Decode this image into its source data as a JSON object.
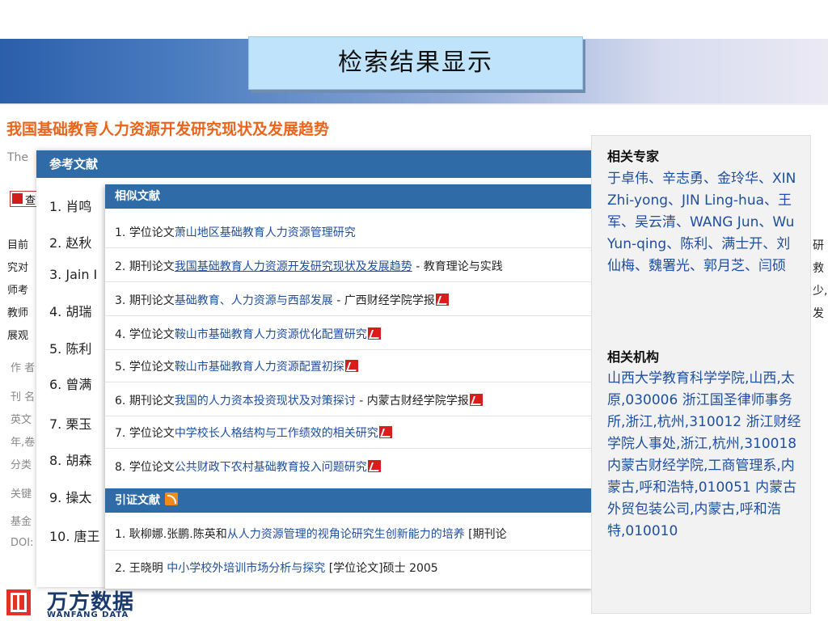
{
  "slide_title": "检索结果显示",
  "article": {
    "title": "我国基础教育人力资源开发研究现状及发展趋势",
    "en_fragment": "The",
    "pdf_label": "查",
    "body_fragments": [
      "目前",
      "究对",
      "师考",
      "教师",
      "展观"
    ],
    "meta_labels": [
      "作 者",
      "刊 名",
      "英文",
      "年,卷",
      "分类",
      "关键",
      "基金",
      "DOI:"
    ]
  },
  "references": {
    "header": "参考文献",
    "items": [
      "1. 肖鸣",
      "2. 赵秋",
      "3. Jain I",
      "4. 胡瑞",
      "5. 陈利",
      "6. 曾满",
      "7. 栗玉",
      "8. 胡森",
      "9. 操太",
      "10. 唐王"
    ]
  },
  "similar": {
    "header": "相似文献",
    "items": [
      {
        "num": "1.",
        "type": "学位论文",
        "title": "萧山地区基础教育人力资源管理研究",
        "source": "",
        "pdf": false,
        "underline": false
      },
      {
        "num": "2.",
        "type": "期刊论文",
        "title": "我国基础教育人力资源开发研究现状及发展趋势",
        "source": " - 教育理论与实践",
        "pdf": false,
        "underline": true
      },
      {
        "num": "3.",
        "type": "期刊论文",
        "title": "基础教育、人力资源与西部发展",
        "source": " - 广西财经学院学报",
        "pdf": true,
        "underline": false
      },
      {
        "num": "4.",
        "type": "学位论文",
        "title": "鞍山市基础教育人力资源优化配置研究",
        "source": "",
        "pdf": true,
        "underline": false
      },
      {
        "num": "5.",
        "type": "学位论文",
        "title": "鞍山市基础教育人力资源配置初探",
        "source": "",
        "pdf": true,
        "underline": false
      },
      {
        "num": "6.",
        "type": "期刊论文",
        "title": "我国的人力资本投资现状及对策探讨",
        "source": " - 内蒙古财经学院学报",
        "pdf": true,
        "underline": false
      },
      {
        "num": "7.",
        "type": "学位论文",
        "title": "中学校长人格结构与工作绩效的相关研究",
        "source": "",
        "pdf": true,
        "underline": false
      },
      {
        "num": "8.",
        "type": "学位论文",
        "title": "公共财政下农村基础教育投入问题研究",
        "source": "",
        "pdf": true,
        "underline": false
      }
    ]
  },
  "citing": {
    "header": "引证文献",
    "items": [
      {
        "prefix": "1. 耿柳娜.张鹏.陈英和",
        "title": "从人力资源管理的视角论研究生创新能力的培养",
        "suffix": " [期刊论"
      },
      {
        "prefix": "2. 王晓明 ",
        "title": "中小学校外培训市场分析与探究",
        "suffix": " [学位论文]硕士 2005"
      }
    ]
  },
  "sidebar": {
    "experts_head": "相关专家",
    "experts": "于卓伟、辛志勇、金玲华、XIN Zhi-yong、JIN Ling-hua、王军、吴云清、WANG Jun、Wu Yun-qing、陈利、满士开、刘仙梅、魏署光、郭月芝、闫硕",
    "orgs_head": "相关机构",
    "orgs": "山西大学教育科学学院,山西,太原,030006 浙江国圣律师事务所,浙江,杭州,310012 浙江财经学院人事处,浙江,杭州,310018 内蒙古财经学院,工商管理系,内蒙古,呼和浩特,010051 内蒙古外贸包装公司,内蒙古,呼和浩特,010010"
  },
  "right_fragments": [
    "研",
    "救",
    "少,",
    "发"
  ],
  "logo": {
    "cn": "万方数据",
    "en": "WANFANG DATA"
  },
  "colors": {
    "header_blue": "#2f6ba7",
    "title_orange": "#e8651b",
    "link_blue": "#1f4fa0",
    "pdf_red": "#d81d1d"
  }
}
